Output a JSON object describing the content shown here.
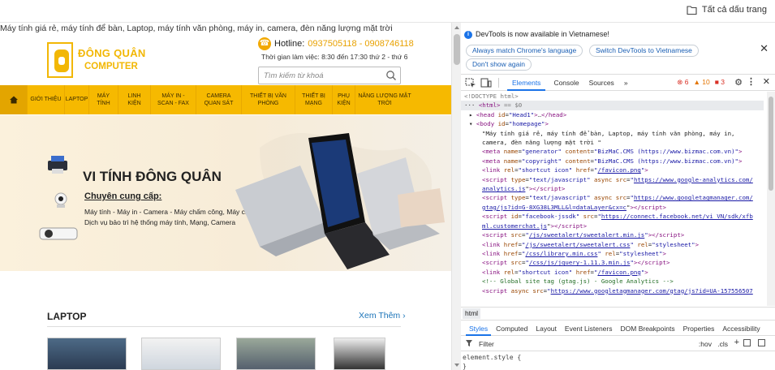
{
  "bookmarks": {
    "all_label": "Tất cả dấu trang"
  },
  "site": {
    "tagline": "Máy tính giá rẻ, máy tính để bàn, Laptop, máy tính văn phòng, máy in, camera, đèn năng lượng mặt trời",
    "logo_line1": "ĐÔNG QUÂN",
    "logo_line2": "COMPUTER",
    "hotline_label": "Hotline:",
    "hotline_numbers": "0937505118 - 0908746118",
    "hours": "Thời gian làm việc: 8:30 đến 17:30 thứ 2 - thứ 6",
    "search_placeholder": "Tìm kiếm từ khoá",
    "nav": [
      {
        "label": "GIỚI THIỆU"
      },
      {
        "label": "LAPTOP"
      },
      {
        "label": "MÁY TÍNH"
      },
      {
        "label": "LINH KIỆN"
      },
      {
        "label": "MÁY IN - SCAN - FAX"
      },
      {
        "label": "CAMERA QUAN SÁT"
      },
      {
        "label": "THIẾT BỊ VĂN PHÒNG"
      },
      {
        "label": "THIẾT BỊ MẠNG"
      },
      {
        "label": "PHỤ KIỆN"
      },
      {
        "label": "NĂNG LƯỢNG MẶT TRỜI"
      }
    ],
    "banner_title": "VI TÍNH ĐÔNG QUÂN",
    "banner_sub": "Chuyên cung cấp:",
    "banner_line1": "Máy tính - Máy in - Camera - Máy chấm công, Máy chiếu",
    "banner_line2": "Dịch vụ bảo trì hệ thống máy tính, Mạng, Camera",
    "section_title": "LAPTOP",
    "see_more": "Xem Thêm"
  },
  "devtools": {
    "notice": "DevTools is now available in Vietnamese!",
    "btn_match": "Always match Chrome's language",
    "btn_switch": "Switch DevTools to Vietnamese",
    "btn_dont": "Don't show again",
    "tabs": [
      "Elements",
      "Console",
      "Sources"
    ],
    "more": "»",
    "errors": "6",
    "warnings": "10",
    "issues": "3",
    "breadcrumb": "html",
    "styles_tabs": [
      "Styles",
      "Computed",
      "Layout",
      "Event Listeners",
      "DOM Breakpoints",
      "Properties",
      "Accessibility"
    ],
    "filter_placeholder": "Filter",
    "hov": ":hov",
    "cls": ".cls",
    "element_style": "element.style {",
    "element_style_close": "}"
  }
}
